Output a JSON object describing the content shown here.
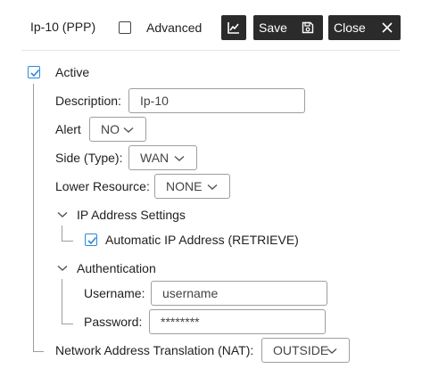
{
  "header": {
    "title": "Ip-10 (PPP)",
    "advanced_label": "Advanced",
    "advanced_checked": false,
    "save_label": "Save",
    "close_label": "Close"
  },
  "form": {
    "active_label": "Active",
    "active_checked": true,
    "description_label": "Description:",
    "description_value": "Ip-10",
    "alert_label": "Alert",
    "alert_value": "NO",
    "side_label": "Side (Type):",
    "side_value": "WAN",
    "lower_resource_label": "Lower Resource:",
    "lower_resource_value": "NONE",
    "ip_section_label": "IP Address Settings",
    "auto_ip_label": "Automatic IP Address (RETRIEVE)",
    "auto_ip_checked": true,
    "auth_section_label": "Authentication",
    "username_label": "Username:",
    "username_value": "username",
    "password_label": "Password:",
    "password_value": "********",
    "nat_label": "Network Address Translation (NAT):",
    "nat_value": "OUTSIDE"
  },
  "colors": {
    "accent": "#2a88d8",
    "button_bg": "#2b2b2b",
    "border": "#9e9e9e"
  },
  "icons": {
    "chart": "chart-icon",
    "save": "floppy-disk-icon",
    "close": "close-icon",
    "chevron": "chevron-down-icon",
    "check": "checkmark-icon"
  }
}
